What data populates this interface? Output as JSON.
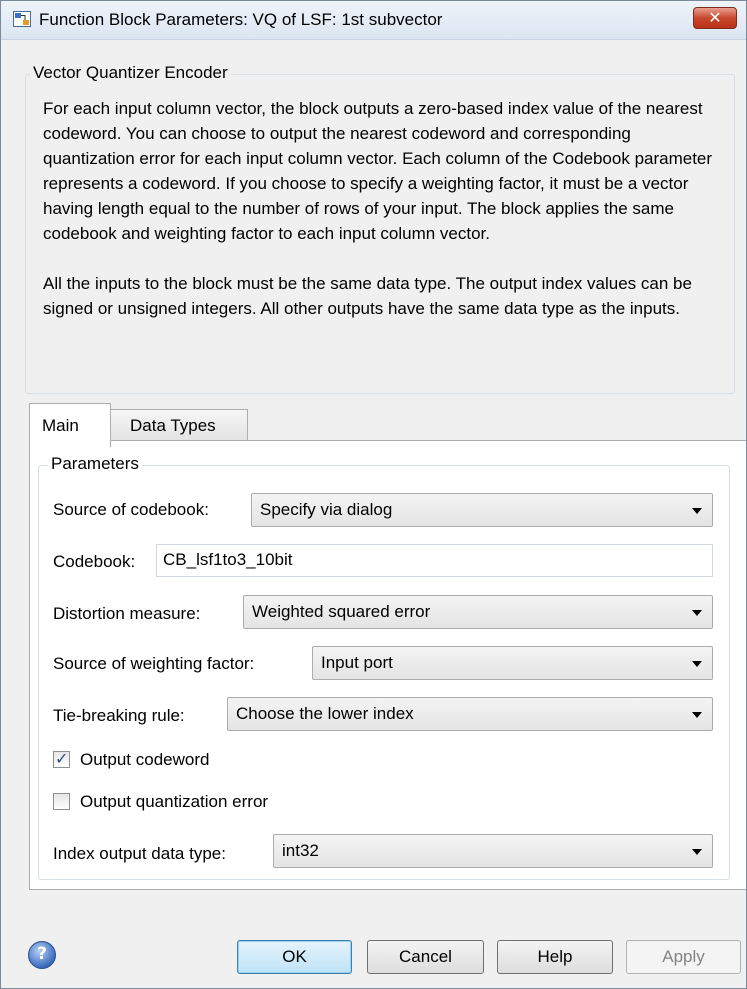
{
  "window": {
    "title": "Function Block Parameters: VQ of LSF: 1st subvector",
    "close_glyph": "✕",
    "icon": "simulink-block-icon"
  },
  "block": {
    "group_title": "Vector Quantizer Encoder",
    "description_paragraphs": [
      "For each input column vector, the block outputs a zero-based index value of the nearest codeword. You can choose to output the nearest codeword and corresponding quantization error for each input column vector. Each column of the Codebook parameter represents a codeword. If you choose to specify a weighting factor, it must be a vector having length equal to the number of rows of your input. The block applies the same codebook and weighting factor to each input column vector.",
      "All the inputs to the block must be the same data type. The output index values can be signed or unsigned integers. All other outputs have the same data type as the inputs."
    ]
  },
  "tabs": [
    {
      "label": "Main",
      "active": true
    },
    {
      "label": "Data Types",
      "active": false
    }
  ],
  "parameters": {
    "group_title": "Parameters",
    "source_of_codebook": {
      "label": "Source of codebook:",
      "value": "Specify via dialog"
    },
    "codebook": {
      "label": "Codebook:",
      "value": "CB_lsf1to3_10bit"
    },
    "distortion_measure": {
      "label": "Distortion measure:",
      "value": "Weighted squared error"
    },
    "source_of_weighting_factor": {
      "label": "Source of weighting factor:",
      "value": "Input port"
    },
    "tie_breaking_rule": {
      "label": "Tie-breaking rule:",
      "value": "Choose the lower index"
    },
    "output_codeword": {
      "label": "Output codeword",
      "checked": true
    },
    "output_quantization_error": {
      "label": "Output quantization error",
      "checked": false
    },
    "index_output_data_type": {
      "label": "Index output data type:",
      "value": "int32"
    }
  },
  "buttons": {
    "help_icon_glyph": "?",
    "ok": "OK",
    "cancel": "Cancel",
    "help": "Help",
    "apply": "Apply"
  },
  "colors": {
    "close_button": "#c8472d",
    "default_button": "#bfe3f7",
    "checkmark": "#2a4c8f"
  }
}
